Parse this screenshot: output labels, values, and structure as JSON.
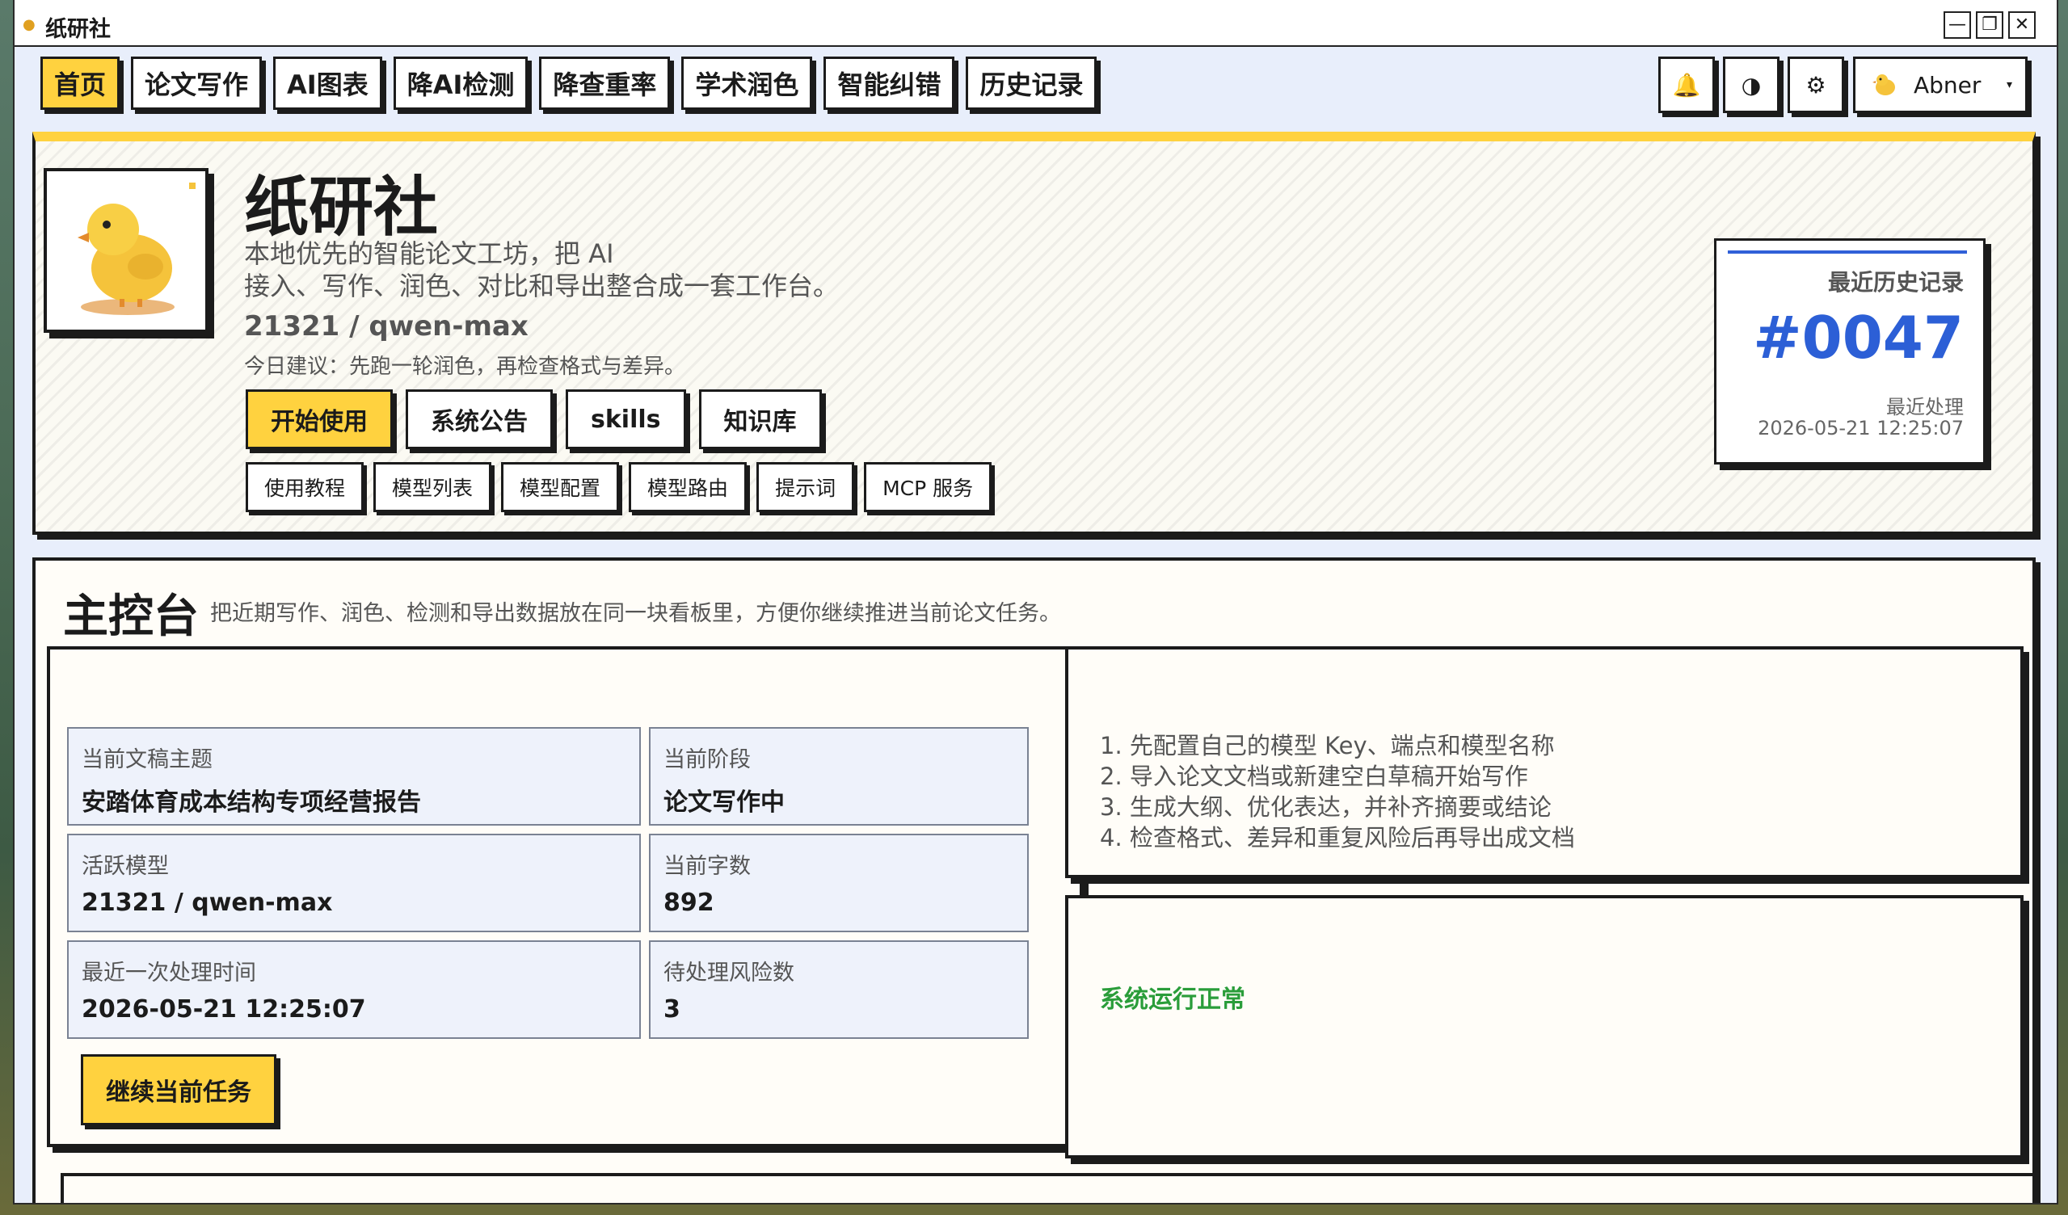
{
  "window": {
    "title": "纸研社",
    "minimize": "—",
    "maximize": "❐",
    "close": "✕"
  },
  "nav": {
    "items": [
      "首页",
      "论文写作",
      "AI图表",
      "降AI检测",
      "降查重率",
      "学术润色",
      "智能纠错",
      "历史记录"
    ],
    "active_index": 0
  },
  "toolbar": {
    "bell": "🔔",
    "theme": "◑",
    "settings": "⚙",
    "user_name": "Abner",
    "caret": "▾"
  },
  "hero": {
    "title": "纸研社",
    "desc_line1": "本地优先的智能论文工坊，把 AI",
    "desc_line2": "接入、写作、润色、对比和导出整合成一套工作台。",
    "model": "21321 / qwen-max",
    "tip": "今日建议：先跑一轮润色，再检查格式与差异。",
    "actions": [
      "开始使用",
      "系统公告",
      "skills",
      "知识库"
    ],
    "links": [
      "使用教程",
      "模型列表",
      "模型配置",
      "模型路由",
      "提示词",
      "MCP 服务"
    ]
  },
  "recent": {
    "label": "最近历史记录",
    "id": "#0047",
    "sub": "最近处理",
    "time": "2026-05-21 12:25:07"
  },
  "console": {
    "title": "主控台",
    "desc": "把近期写作、润色、检测和导出数据放在同一块看板里，方便你继续推进当前论文任务。",
    "cells": [
      {
        "k": "当前文稿主题",
        "v": "安踏体育成本结构专项经营报告"
      },
      {
        "k": "当前阶段",
        "v": "论文写作中"
      },
      {
        "k": "活跃模型",
        "v": "21321 / qwen-max"
      },
      {
        "k": "当前字数",
        "v": "892"
      },
      {
        "k": "最近一次处理时间",
        "v": "2026-05-21 12:25:07"
      },
      {
        "k": "待处理风险数",
        "v": "3"
      }
    ],
    "continue_button": "继续当前任务",
    "steps": [
      "1. 先配置自己的模型 Key、端点和模型名称",
      "2. 导入论文文档或新建空白草稿开始写作",
      "3. 生成大纲、优化表达，并补齐摘要或结论",
      "4. 检查格式、差异和重复风险后再导出成文档"
    ],
    "status": "系统运行正常"
  },
  "colors": {
    "accent": "#ffd23f",
    "link_blue": "#2c5fd6",
    "ok_green": "#2a9d3a"
  }
}
